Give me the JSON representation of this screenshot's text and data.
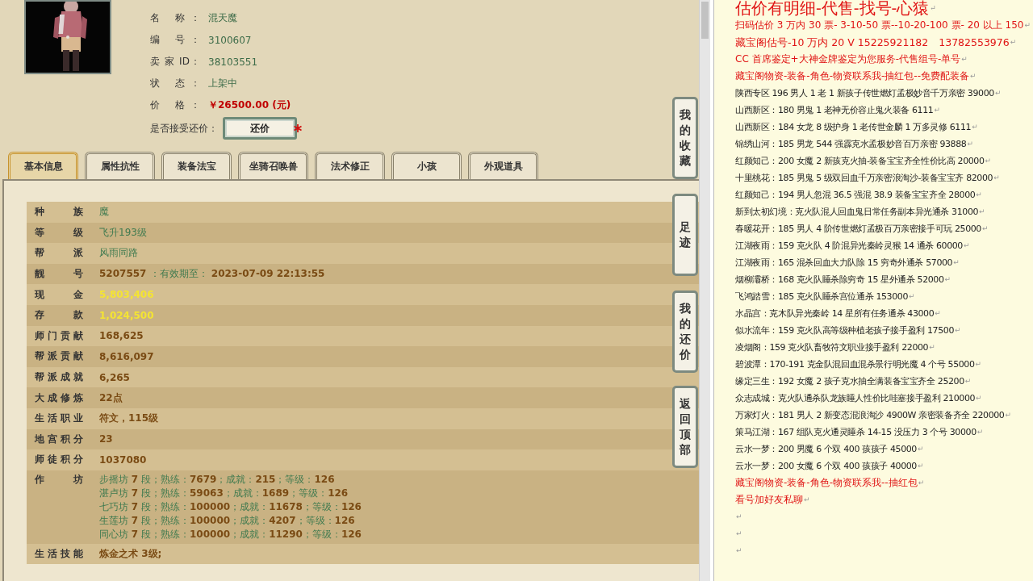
{
  "character": {
    "fields": [
      {
        "label": "名 称：",
        "value": "混天魔",
        "kind": "text"
      },
      {
        "label": "编 号：",
        "value": "3100607",
        "kind": "text"
      },
      {
        "label": "卖 家 ID：",
        "value": "38103551",
        "kind": "text"
      },
      {
        "label": "状 态：",
        "value": "上架中",
        "kind": "text"
      },
      {
        "label": "价 格：",
        "value": "￥26500.00 (元)",
        "kind": "price"
      }
    ],
    "bargain": {
      "label": "是否接受还价：",
      "button": "还价"
    }
  },
  "tabs": [
    {
      "label": "基本信息",
      "selected": true
    },
    {
      "label": "属性抗性",
      "selected": false
    },
    {
      "label": "装备法宝",
      "selected": false
    },
    {
      "label": "坐骑召唤兽",
      "selected": false
    },
    {
      "label": "法术修正",
      "selected": false
    },
    {
      "label": "小孩",
      "selected": false
    },
    {
      "label": "外观道具",
      "selected": false
    }
  ],
  "info_table": [
    {
      "label": "种 族",
      "kind": "text",
      "lines": [
        "魔"
      ]
    },
    {
      "label": "等 级",
      "kind": "text",
      "lines": [
        "飞升193级"
      ]
    },
    {
      "label": "帮 派",
      "kind": "text",
      "lines": [
        "风雨同路"
      ]
    },
    {
      "label": "靓 号",
      "kind": "number",
      "lines": [
        "5207557 *：有效期至：* 2023-07-09 22:13:55"
      ]
    },
    {
      "label": "现 金",
      "kind": "money",
      "lines": [
        "5,803,406"
      ]
    },
    {
      "label": "存 款",
      "kind": "money",
      "lines": [
        "1,024,500"
      ]
    },
    {
      "label": "师门贡献",
      "kind": "number",
      "lines": [
        "168,625"
      ]
    },
    {
      "label": "帮派贡献",
      "kind": "number",
      "lines": [
        "8,616,097"
      ]
    },
    {
      "label": "帮派成就",
      "kind": "number",
      "lines": [
        "6,265"
      ]
    },
    {
      "label": "大成修炼",
      "kind": "number",
      "lines": [
        "22点"
      ]
    },
    {
      "label": "生活职业",
      "kind": "number",
      "lines": [
        "符文，115级"
      ]
    },
    {
      "label": "地宫积分",
      "kind": "number",
      "lines": [
        "23"
      ]
    },
    {
      "label": "师徒积分",
      "kind": "number",
      "lines": [
        "1037080"
      ]
    },
    {
      "label": "作 坊",
      "kind": "mixed",
      "lines": [
        "步摇坊 **7** 段；熟练：**7679**；成就：**215**；等级：**126**",
        "湛卢坊 **7** 段；熟练：**59063**；成就：**1689**；等级：**126**",
        "七巧坊 **7** 段；熟练：**100000**；成就：**11678**；等级：**126**",
        "生莲坊 **7** 段；熟练：**100000**；成就：**4207**；等级：**126**",
        "同心坊 **7** 段；熟练：**100000**；成就：**11290**；等级：**126**"
      ]
    },
    {
      "label": "生活技能",
      "kind": "number",
      "lines": [
        "炼金之术 3级;"
      ]
    }
  ],
  "side_buttons": [
    {
      "label": "我的收藏"
    },
    {
      "label": "足迹"
    },
    {
      "label": "我的还价"
    },
    {
      "label": "返回顶部"
    }
  ],
  "notes": [
    {
      "kind": "heading",
      "text": "估价有明细-代售-找号-心猿",
      "end": "↵"
    },
    {
      "kind": "promo",
      "text": "扫码估价 3 万内 30 票- 3-10-50 票--10-20-100 票- 20 以上 150",
      "end": "↵"
    },
    {
      "kind": "contact",
      "text": "藏宝阁估号-10 万内 20 V 15225921182　13782553976",
      "end": "↵"
    },
    {
      "kind": "promo",
      "text": "CC 首席鉴定+大神金牌鉴定为您服务-代售组号-单号",
      "end": "↵"
    },
    {
      "kind": "promo",
      "text": "藏宝阁物资-装备-角色-物资联系我-抽红包--免费配装备",
      "end": "↵"
    },
    {
      "kind": "listing",
      "text": "陕西专区 196 男人 1 老 1 新孩子传世燃灯孟极妙音千万亲密 39000",
      "end": "↵"
    },
    {
      "kind": "listing",
      "text": "山西新区：180 男鬼 1 老神无价容止鬼火装备 6111",
      "end": "↵"
    },
    {
      "kind": "listing",
      "text": "山西新区：184 女龙 8 级护身 1 老传世金麟 1 万多灵修 6111",
      "end": "↵"
    },
    {
      "kind": "listing",
      "text": "锦绣山河：185 男龙 544 强霹克水孟极妙音百万亲密 93888",
      "end": "↵"
    },
    {
      "kind": "listing",
      "text": "红颜知己：200 女魔 2 新孩克火抽-装备宝宝齐全性价比高 20000",
      "end": "↵"
    },
    {
      "kind": "listing",
      "text": "十里桃花：185 男鬼 5 级双回血千万亲密浪淘沙-装备宝宝齐 82000",
      "end": "↵"
    },
    {
      "kind": "listing",
      "text": "红颜知己：194 男人忽混 36.5 强混 38.9 装备宝宝齐全 28000",
      "end": "↵"
    },
    {
      "kind": "listing",
      "text": "新到太初幻境：克火队混人回血鬼日常任务副本异光通杀 31000",
      "end": "↵"
    },
    {
      "kind": "listing",
      "text": "春暖花开：185 男人 4 阶传世燃灯孟极百万亲密接手可玩 25000",
      "end": "↵"
    },
    {
      "kind": "listing",
      "text": "江湖夜雨：159 克火队 4 阶混异光秦岭灵猴 14 通杀 60000",
      "end": "↵"
    },
    {
      "kind": "listing",
      "text": "江湖夜雨：165 混杀回血大力队除 15 穷奇外通杀 57000",
      "end": "↵"
    },
    {
      "kind": "listing",
      "text": "烟柳灞桥：168 克火队睡杀除穷奇 15 星外通杀 52000",
      "end": "↵"
    },
    {
      "kind": "listing",
      "text": "飞鸿踏雪：185 克火队睡杀宫位通杀 153000",
      "end": "↵"
    },
    {
      "kind": "listing",
      "text": "水晶宫：克木队异光秦岭 14 星所有任务通杀 43000",
      "end": "↵"
    },
    {
      "kind": "listing",
      "text": "似水流年：159 克火队高等级种植老孩子接手盈利 17500",
      "end": "↵"
    },
    {
      "kind": "listing",
      "text": "凌烟阁：159 克火队畜牧符文职业接手盈利 22000",
      "end": "↵"
    },
    {
      "kind": "listing",
      "text": "碧波潭：170-191 克金队混回血混杀景行明光魔 4 个号 55000",
      "end": "↵"
    },
    {
      "kind": "listing",
      "text": "缘定三生：192 女魔 2 孩子克水抽全满装备宝宝齐全 25200",
      "end": "↵"
    },
    {
      "kind": "listing",
      "text": "众志成城：克火队通杀队龙族睡人性价比哇塞接手盈利 210000",
      "end": "↵"
    },
    {
      "kind": "listing",
      "text": "万家灯火：181 男人 2 新变态混浪淘沙 4900W 亲密装备齐全 220000",
      "end": "↵"
    },
    {
      "kind": "listing",
      "text": "策马江湖：167 组队克火通灵睡杀 14-15 没压力 3 个号 30000",
      "end": "↵"
    },
    {
      "kind": "listing",
      "text": "云水一梦：200 男魔 6 个双 400 孩孩子 45000",
      "end": "↵"
    },
    {
      "kind": "listing",
      "text": "云水一梦：200 女魔 6 个双 400 孩孩子 40000",
      "end": "↵"
    },
    {
      "kind": "promo",
      "text": "藏宝阁物资-装备-角色-物资联系我--抽红包",
      "end": "↵"
    },
    {
      "kind": "promo",
      "text": "看号加好友私聊",
      "end": "↵"
    },
    {
      "kind": "blank",
      "end": "↵"
    },
    {
      "kind": "blank",
      "end": "↵"
    },
    {
      "kind": "blank",
      "end": "↵"
    }
  ]
}
